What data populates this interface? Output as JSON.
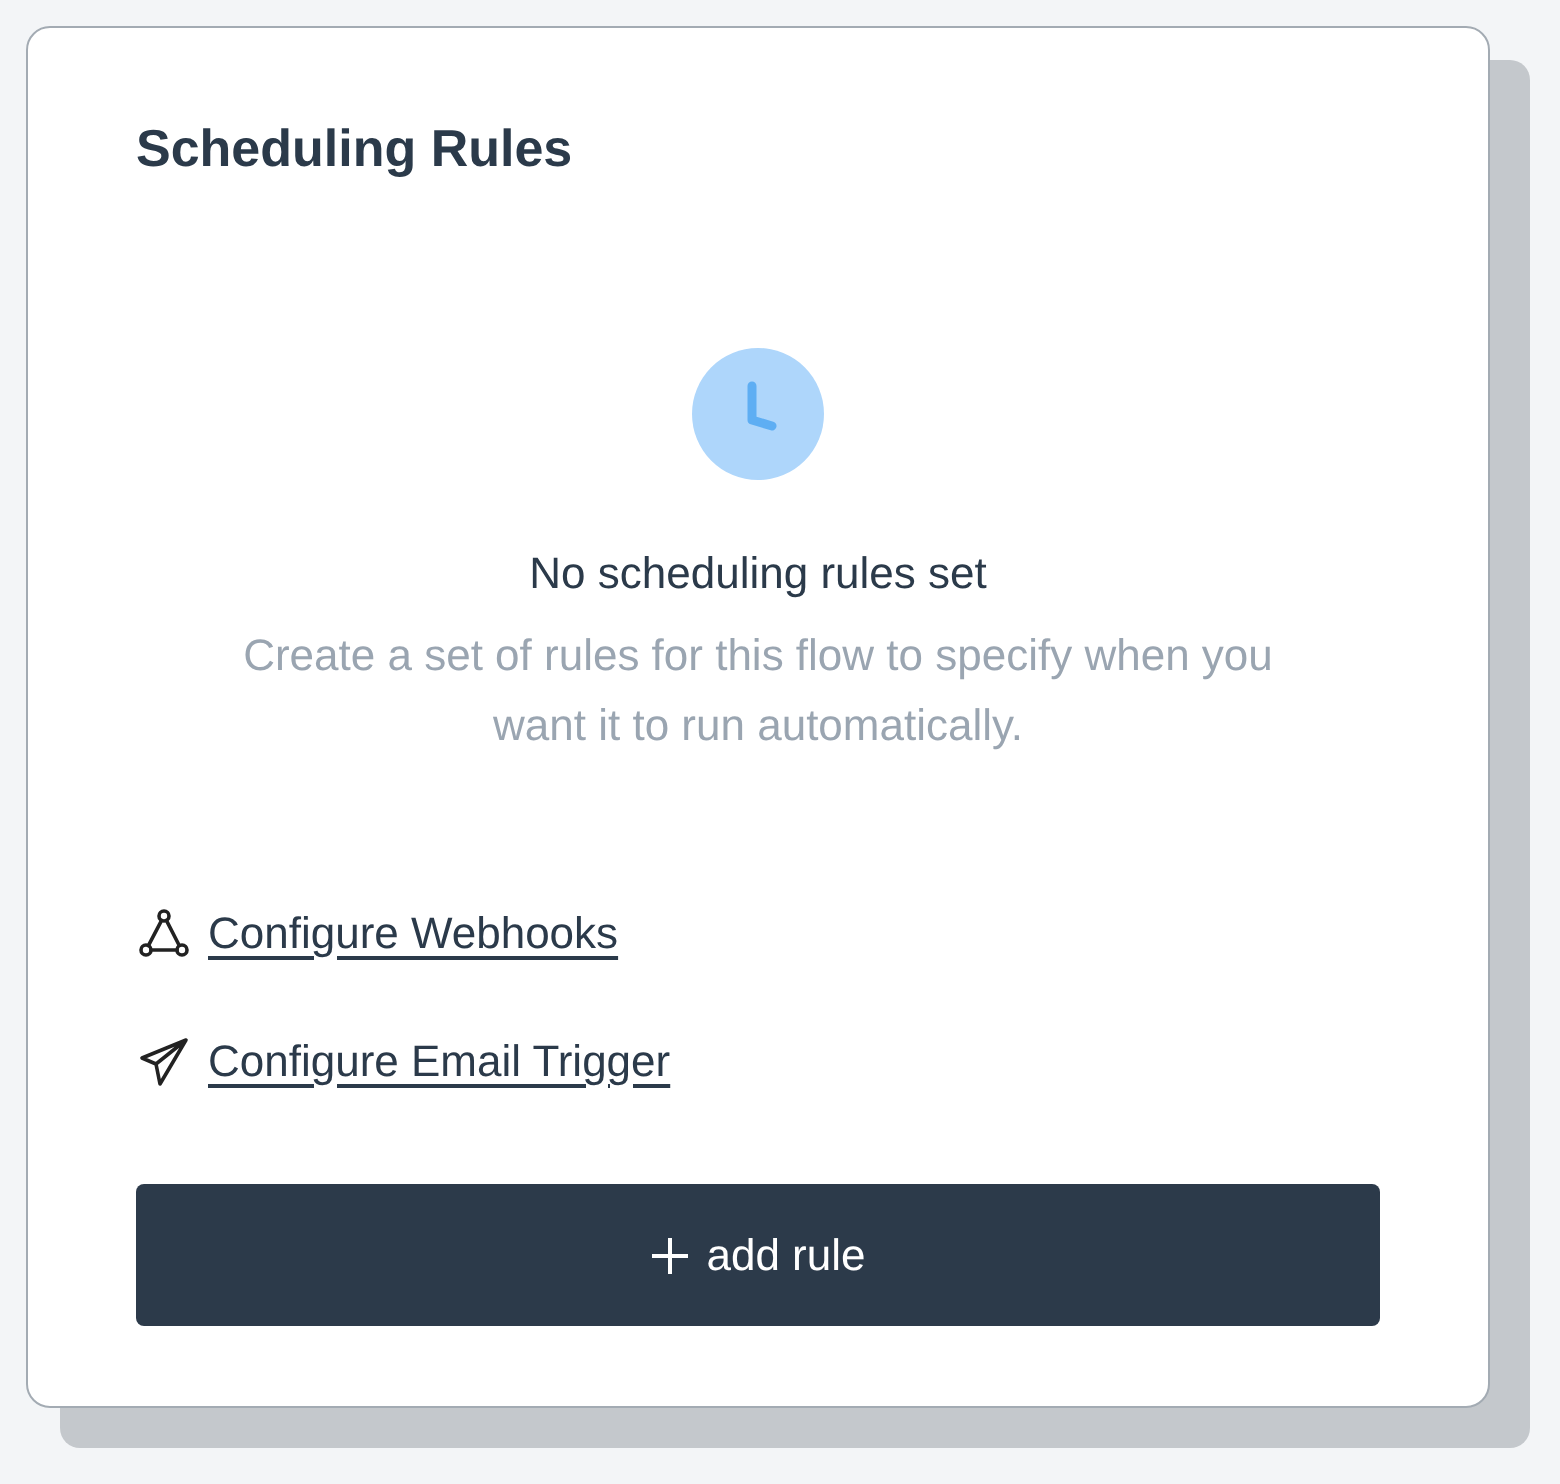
{
  "panel": {
    "title": "Scheduling Rules"
  },
  "empty_state": {
    "heading": "No scheduling rules set",
    "description": "Create a set of rules for this flow to specify when you want it to run automatically."
  },
  "links": [
    {
      "kind": "webhook",
      "label": "Configure Webhooks"
    },
    {
      "kind": "email",
      "label": "Configure Email Trigger"
    }
  ],
  "add_button": {
    "label": "add rule"
  }
}
